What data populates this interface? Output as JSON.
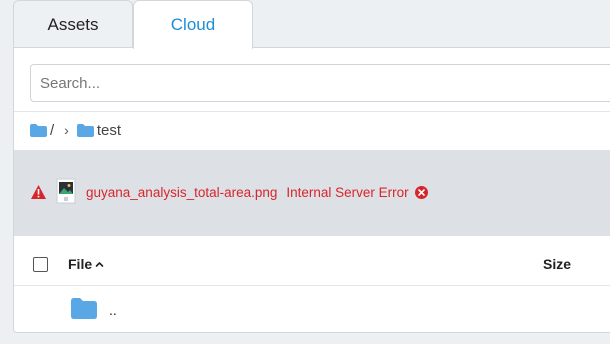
{
  "tabs": [
    {
      "label": "Assets",
      "active": false
    },
    {
      "label": "Cloud",
      "active": true
    }
  ],
  "search": {
    "placeholder": "Search...",
    "value": ""
  },
  "breadcrumb": {
    "root": "/",
    "separator": "›",
    "current": "test"
  },
  "error": {
    "filename": "guyana_analysis_total-area.png",
    "message": "Internal Server Error",
    "icon": "warning-icon"
  },
  "table": {
    "columns": {
      "file": "File",
      "size": "Size"
    },
    "rows": [
      {
        "name": "..",
        "icon": "folder-icon"
      }
    ]
  },
  "colors": {
    "accent": "#1d8fd4",
    "folder": "#5aa7e6",
    "error": "#d6262b",
    "error_band": "#dde1e5"
  }
}
